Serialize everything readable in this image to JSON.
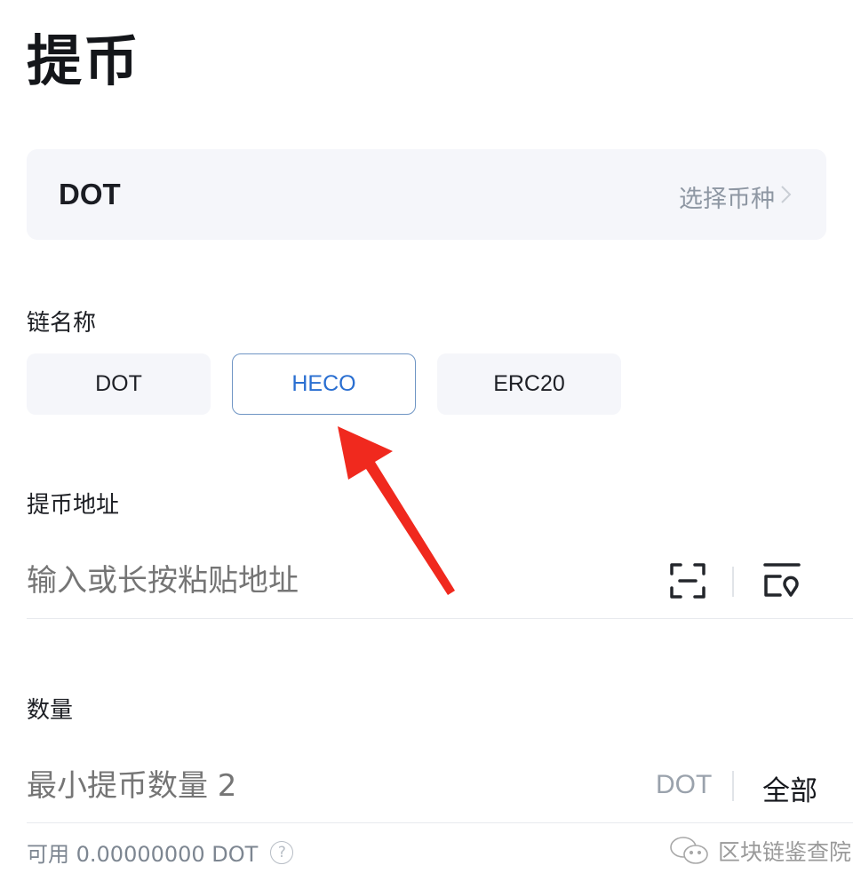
{
  "header": {
    "title": "提币"
  },
  "coin_selector": {
    "coin": "DOT",
    "action_label": "选择币种",
    "icon": "chevron-right-icon"
  },
  "chain": {
    "label": "链名称",
    "options": [
      {
        "label": "DOT",
        "selected": false
      },
      {
        "label": "HECO",
        "selected": true
      },
      {
        "label": "ERC20",
        "selected": false
      }
    ],
    "selected_color": "#2a6fd1"
  },
  "address": {
    "label": "提币地址",
    "placeholder": "输入或长按粘贴地址",
    "value": "",
    "icons": [
      "scan-icon",
      "address-book-icon"
    ]
  },
  "amount": {
    "label": "数量",
    "placeholder": "最小提币数量 2",
    "value": "",
    "unit": "DOT",
    "all_label": "全部"
  },
  "available": {
    "text": "可用 0.00000000 DOT",
    "help_glyph": "?"
  },
  "annotation": {
    "type": "red-arrow",
    "points_to": "HECO",
    "color": "#f0291e"
  },
  "watermark": {
    "text": "区块链鉴查院",
    "icon": "wechat-icon"
  }
}
